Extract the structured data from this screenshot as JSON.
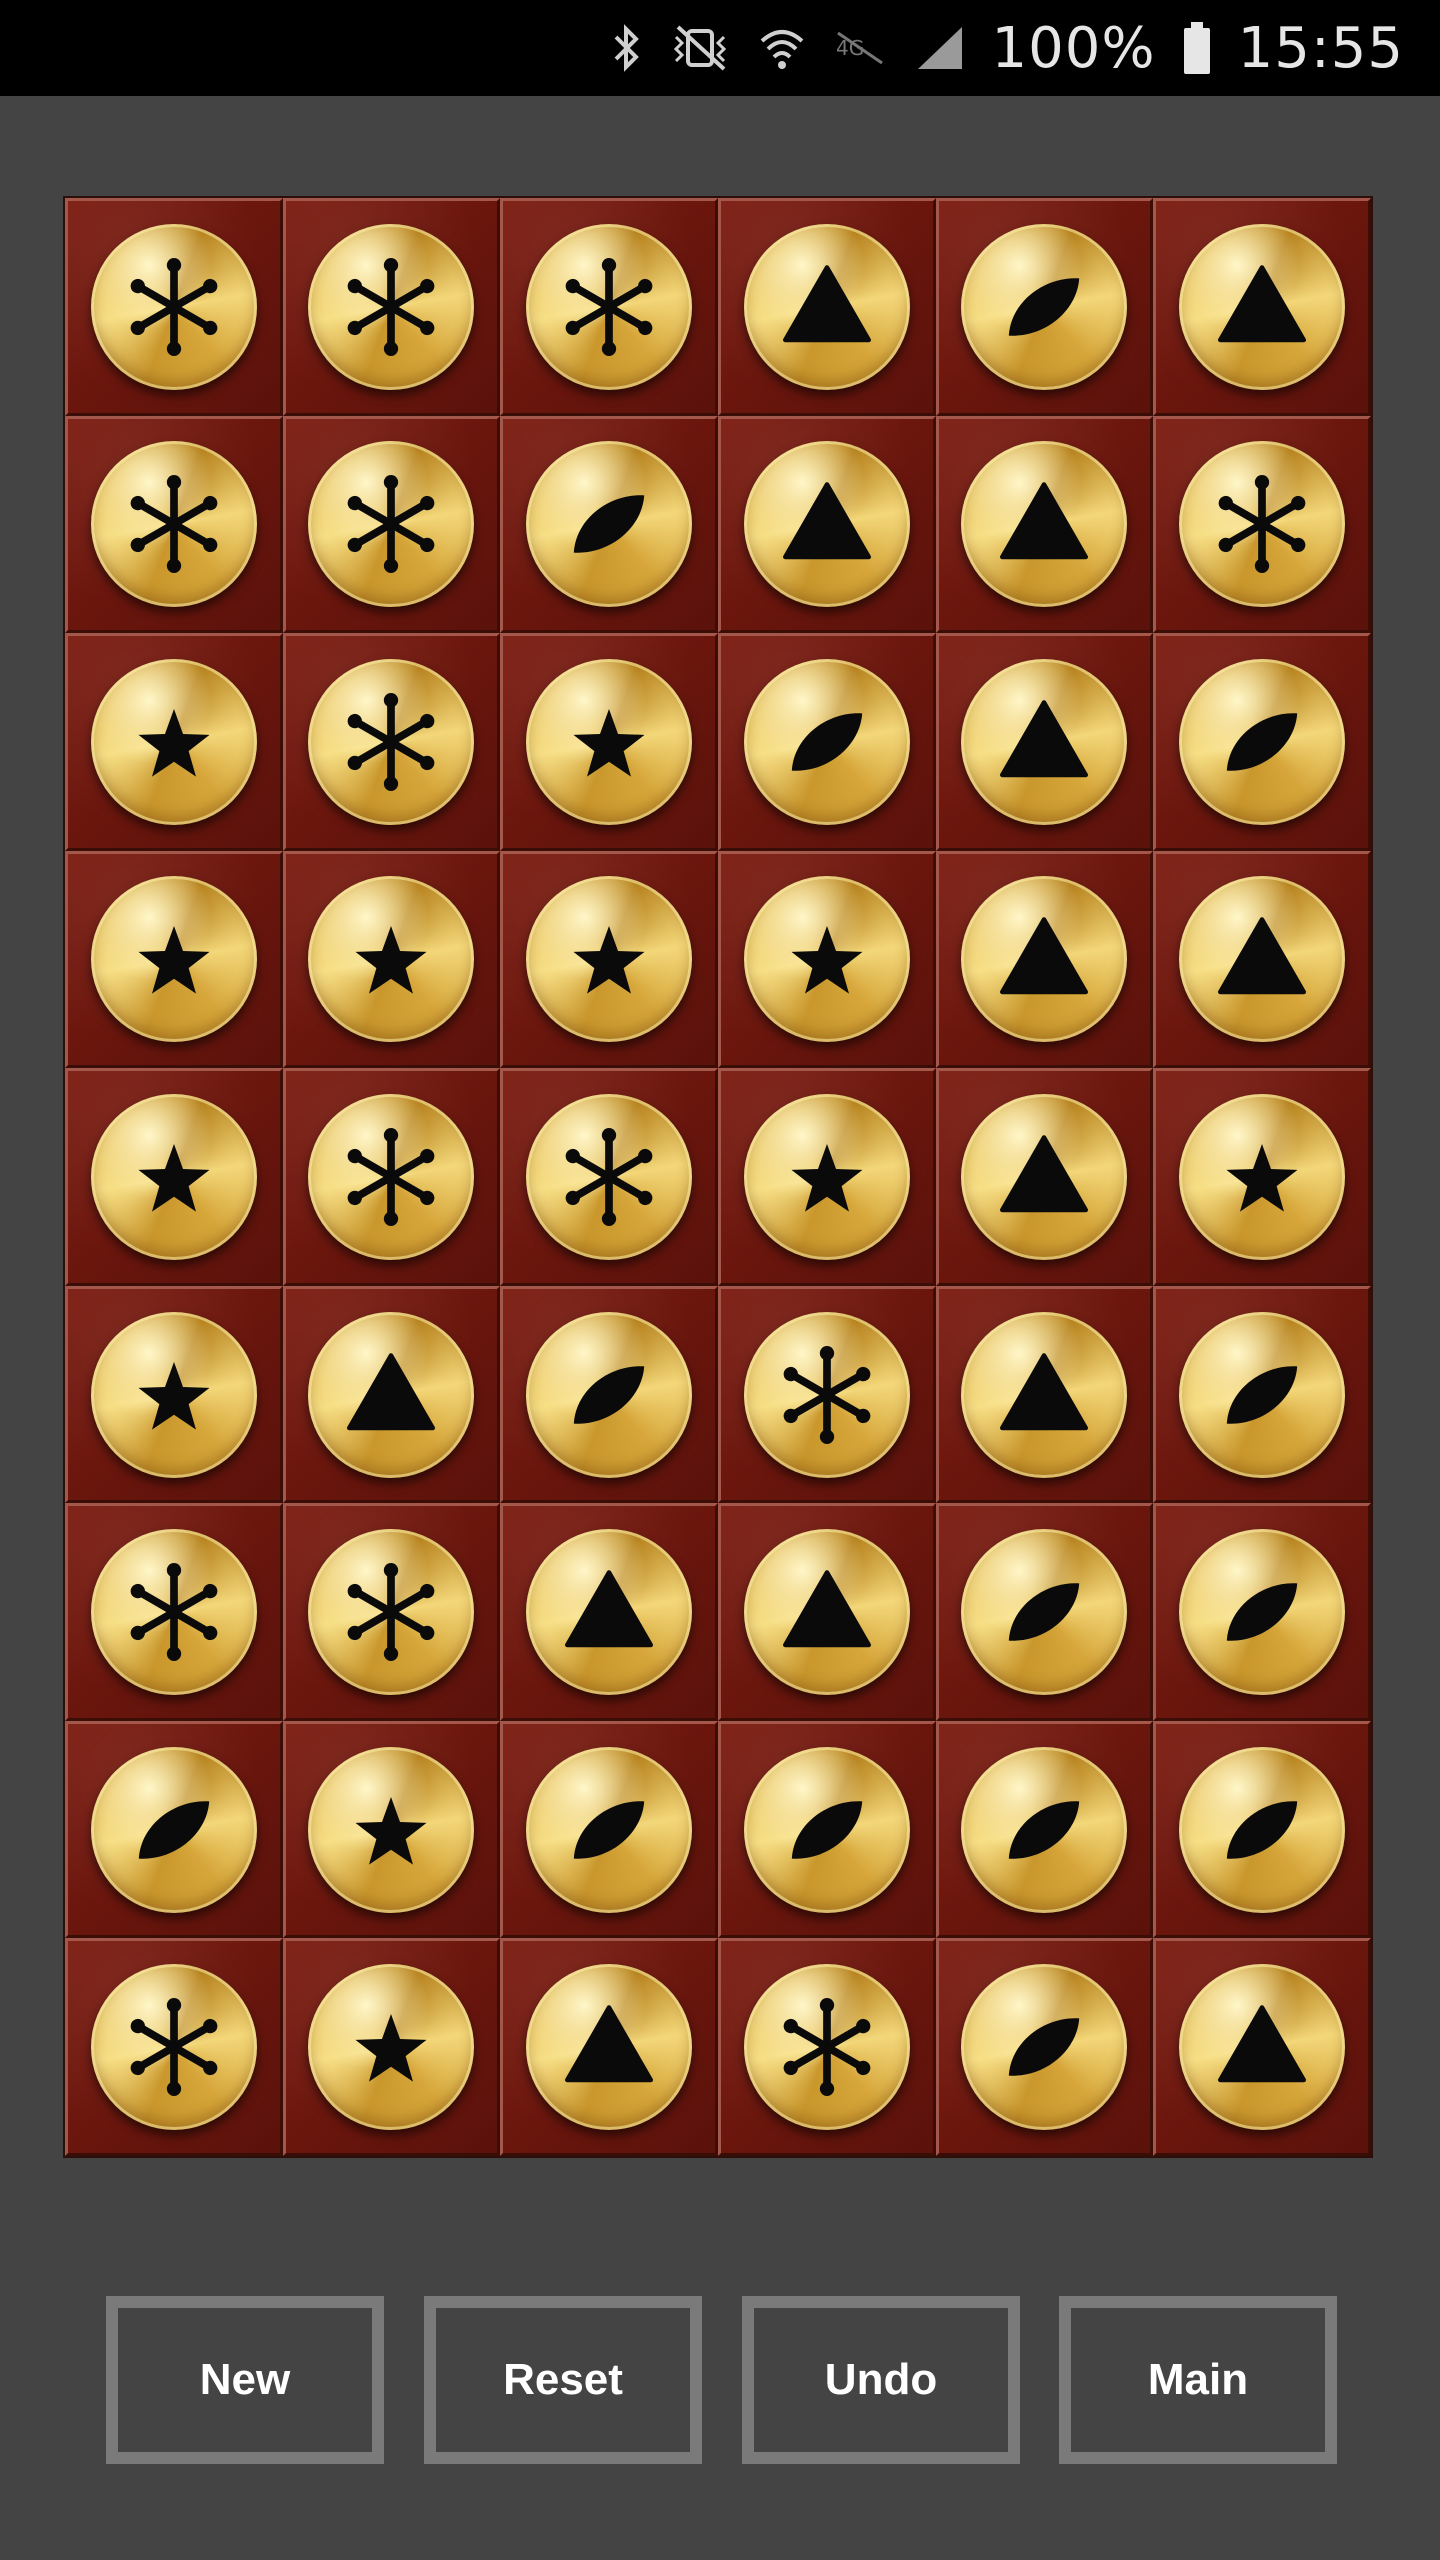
{
  "status_bar": {
    "battery_percent": "100%",
    "time": "15:55",
    "icons": [
      "bluetooth-icon",
      "vibrate-mute-icon",
      "wifi-icon",
      "lte-icon",
      "signal-icon",
      "battery-icon"
    ]
  },
  "board": {
    "columns": 6,
    "rows": 9,
    "symbols": {
      "asterisk": "asterisk-icon",
      "triangle": "triangle-icon",
      "leaf": "leaf-icon",
      "star": "star-icon"
    },
    "grid": [
      [
        "asterisk",
        "asterisk",
        "asterisk",
        "triangle",
        "leaf",
        "triangle"
      ],
      [
        "asterisk",
        "asterisk",
        "leaf",
        "triangle",
        "triangle",
        "asterisk"
      ],
      [
        "star",
        "asterisk",
        "star",
        "leaf",
        "triangle",
        "leaf"
      ],
      [
        "star",
        "star",
        "star",
        "star",
        "triangle",
        "triangle"
      ],
      [
        "star",
        "asterisk",
        "asterisk",
        "star",
        "triangle",
        "star"
      ],
      [
        "star",
        "triangle",
        "leaf",
        "asterisk",
        "triangle",
        "leaf"
      ],
      [
        "asterisk",
        "asterisk",
        "triangle",
        "triangle",
        "leaf",
        "leaf"
      ],
      [
        "leaf",
        "star",
        "leaf",
        "leaf",
        "leaf",
        "leaf"
      ],
      [
        "asterisk",
        "star",
        "triangle",
        "asterisk",
        "leaf",
        "triangle"
      ]
    ]
  },
  "controls": {
    "new_label": "New",
    "reset_label": "Reset",
    "undo_label": "Undo",
    "main_label": "Main"
  },
  "colors": {
    "background": "#444444",
    "cell_red": "#6a160d",
    "gold": "#e2b84d",
    "button_border": "#7a7a7a"
  }
}
